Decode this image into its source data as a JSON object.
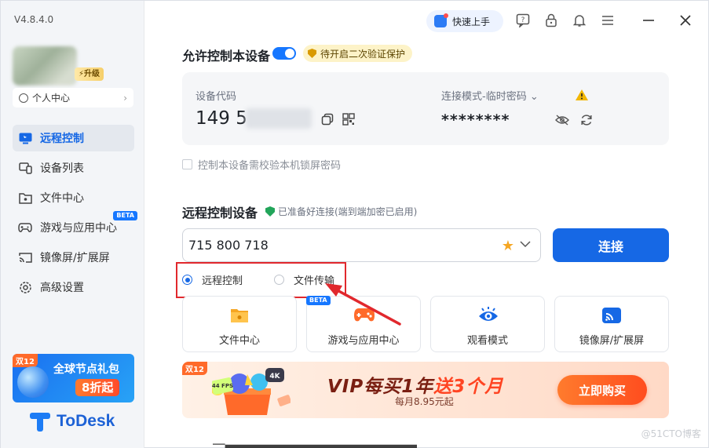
{
  "app": {
    "version": "V4.8.4.0",
    "brand": "ToDesk"
  },
  "sidebar": {
    "upgrade_label": "升级",
    "personal_center": "个人中心",
    "items": [
      {
        "label": "远程控制",
        "icon": "monitor-icon",
        "active": true
      },
      {
        "label": "设备列表",
        "icon": "device-list-icon",
        "active": false
      },
      {
        "label": "文件中心",
        "icon": "folder-icon",
        "active": false
      },
      {
        "label": "游戏与应用中心",
        "icon": "gamepad-icon",
        "active": false,
        "badge": "BETA"
      },
      {
        "label": "镜像屏/扩展屏",
        "icon": "cast-icon",
        "active": false
      },
      {
        "label": "高级设置",
        "icon": "gear-icon",
        "active": false
      }
    ],
    "promo": {
      "tag": "双12",
      "title": "全球节点礼包",
      "discount": "8折起"
    }
  },
  "topbar": {
    "quickstart": "快速上手"
  },
  "allow_control": {
    "title": "允许控制本设备",
    "toggle_on": true,
    "warning": "待开启二次验证保护",
    "device_code_label": "设备代码",
    "device_code_visible": "149 5",
    "mode_label": "连接模式-临时密码",
    "password": "********",
    "lock_screen_check": "控制本设备需校验本机锁屏密码"
  },
  "remote": {
    "title": "远程控制设备",
    "status": "已准备好连接(端到端加密已启用)",
    "input_value": "715 800 718",
    "connect_label": "连接",
    "radio_remote": "远程控制",
    "radio_file": "文件传输",
    "tiles": [
      {
        "label": "文件中心"
      },
      {
        "label": "游戏与应用中心",
        "badge": "BETA"
      },
      {
        "label": "观看模式"
      },
      {
        "label": "镜像屏/扩展屏"
      }
    ]
  },
  "banner": {
    "tag": "双12",
    "fps": "144 FPS",
    "k4": "4K",
    "vip_a": "VIP每买1年",
    "vip_b": "送",
    "vip_c": "3个月",
    "sub": "每月8.95元起",
    "buy_label": "立即购买"
  },
  "watermark": "@51CTO博客",
  "colors": {
    "accent": "#1668e5",
    "highlight_box": "#e1282d",
    "promo": "#ff5a24"
  }
}
